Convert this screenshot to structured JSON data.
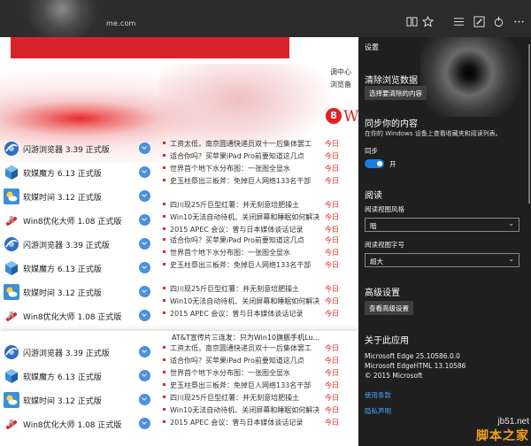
{
  "browser": {
    "address_fragment": "me.com",
    "icons": [
      "reading-view-icon",
      "favorite-star-icon",
      "hub-icon",
      "web-note-icon",
      "share-icon",
      "more-icon"
    ]
  },
  "webpage": {
    "nav_fragments": [
      "调中心",
      "浏览备"
    ],
    "circle_digit": "8",
    "w_fragment": "W",
    "apps_group1": [
      {
        "name": "闪游浏览器 3.39 正式版",
        "icon": "browser-globe-icon"
      },
      {
        "name": "软媒魔方 6.13 正式版",
        "icon": "cube-icon"
      },
      {
        "name": "软媒时间 3.12 正式版",
        "icon": "weather-icon"
      },
      {
        "name": "Win8优化大师 1.08 正式版",
        "icon": "swiss-knife-icon"
      },
      {
        "name": "闪游浏览器 3.39 正式版",
        "icon": "browser-globe-icon"
      },
      {
        "name": "软媒魔方 6.13 正式版",
        "icon": "cube-icon"
      },
      {
        "name": "软媒时间 3.12 正式版",
        "icon": "weather-icon"
      },
      {
        "name": "Win8优化大师 1.08 正式版",
        "icon": "swiss-knife-icon"
      }
    ],
    "apps_group2": [
      {
        "name": "闪游浏览器 3.39 正式版",
        "icon": "browser-globe-icon"
      },
      {
        "name": "软媒魔方 6.13 正式版",
        "icon": "cube-icon"
      },
      {
        "name": "软媒时间 3.12 正式版",
        "icon": "weather-icon"
      },
      {
        "name": "Win8优化大师 1.08 正式版",
        "icon": "swiss-knife-icon"
      }
    ],
    "news_group1": [
      {
        "title": "工资太低，南京圆通快递员双十一后集体罢工",
        "date": "今日"
      },
      {
        "title": "适合你吗？买苹果iPad Pro前要知道这几点",
        "date": "今日"
      },
      {
        "title": "世界首个地下水分布图：一张图全显水",
        "date": "今日"
      },
      {
        "title": "史玉柱祭出三板斧：免掉巨人网络133名干部",
        "date": "今日"
      },
      {
        "title": "四川现25斤巨型红薯：并无刻意培肥操土",
        "date": "今日"
      },
      {
        "title": "Win10无法自动待机、关闭屏幕和睡眠如何解决",
        "date": "今日"
      },
      {
        "title": "2015 APEC 会议：曾与日本媒体谈话记录",
        "date": "今日"
      },
      {
        "title": "适合你吗？买苹果iPad Pro前要知道这几点",
        "date": "今日"
      },
      {
        "title": "世界首个地下水分布图：一张图全显水",
        "date": "今日"
      },
      {
        "title": "史玉柱祭出三板斧：免掉巨人网络133名干部",
        "date": "今日"
      },
      {
        "title": "四川现25斤巨型红薯：并无刻意培肥操土",
        "date": "今日"
      },
      {
        "title": "Win10无法自动待机、关闭屏幕和睡眠如何解决",
        "date": "今日"
      },
      {
        "title": "2015 APEC 会议：曾与日本媒体谈话记录",
        "date": "今日"
      }
    ],
    "news_group2_header": "AT&T宣传片三连发：只为Win10旗舰手机Lu...",
    "news_group2": [
      {
        "title": "工资太低，南京圆通快递员双十一后集体罢工",
        "date": "今日"
      },
      {
        "title": "适合你吗？买苹果iPad Pro前要知道这几点",
        "date": "今日"
      },
      {
        "title": "世界首个地下水分布图：一张图全显水",
        "date": "今日"
      },
      {
        "title": "史玉柱祭出三板斧：免掉巨人网络133名干部",
        "date": "今日"
      },
      {
        "title": "四川现25斤巨型红薯：并无刻意培肥操土",
        "date": "今日"
      },
      {
        "title": "Win10无法自动待机、关闭屏幕和睡眠如何解决",
        "date": "今日"
      },
      {
        "title": "2015 APEC 会议：曾与日本媒体谈话记录",
        "date": "今日"
      }
    ]
  },
  "settings": {
    "title": "设置",
    "clear_heading": "清除浏览数据",
    "clear_button": "选择要清除的内容",
    "sync_heading": "同步你的内容",
    "sync_desc": "在你的 Windows 设备上查看收藏夹和阅读列表。",
    "sync_label": "同步",
    "sync_state": "开",
    "reading_heading": "阅读",
    "reading_style_label": "阅读视图风格",
    "reading_style_value": "暗",
    "reading_font_label": "阅读视图字号",
    "reading_font_value": "超大",
    "advanced_heading": "高级设置",
    "advanced_button": "查看高级设置",
    "about_heading": "关于此应用",
    "about_lines": [
      "Microsoft Edge 25.10586.0.0",
      "Microsoft EdgeHTML 13.10586",
      "© 2015 Microsoft"
    ],
    "terms_link": "使用条款",
    "privacy_link": "隐私声明"
  },
  "watermark": {
    "site": "jb51.net",
    "cn": "脚本之家"
  },
  "colors": {
    "panel_bg": "#1f1f1f",
    "toggle_accent": "#1b7fe0",
    "link": "#4aa3ff",
    "brand_red": "#d8232a",
    "date_red": "#e02020",
    "watermark_orange": "#f0a020"
  }
}
